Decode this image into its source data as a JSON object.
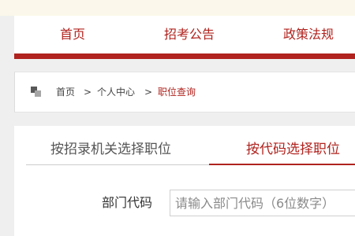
{
  "nav": {
    "items": [
      {
        "label": "首页"
      },
      {
        "label": "招考公告"
      },
      {
        "label": "政策法规"
      }
    ]
  },
  "breadcrumb": {
    "home": "首页",
    "separator": ">",
    "center": "个人中心",
    "current": "职位查询"
  },
  "tabs": [
    {
      "label": "按招录机关选择职位",
      "active": false
    },
    {
      "label": "按代码选择职位",
      "active": true
    }
  ],
  "form": {
    "department_code": {
      "label": "部门代码",
      "value": "",
      "placeholder": "请输入部门代码（6位数字）"
    }
  },
  "colors": {
    "accent": "#b0231e",
    "page_bg": "#efefef",
    "top_strip": "#fbf7ea"
  }
}
